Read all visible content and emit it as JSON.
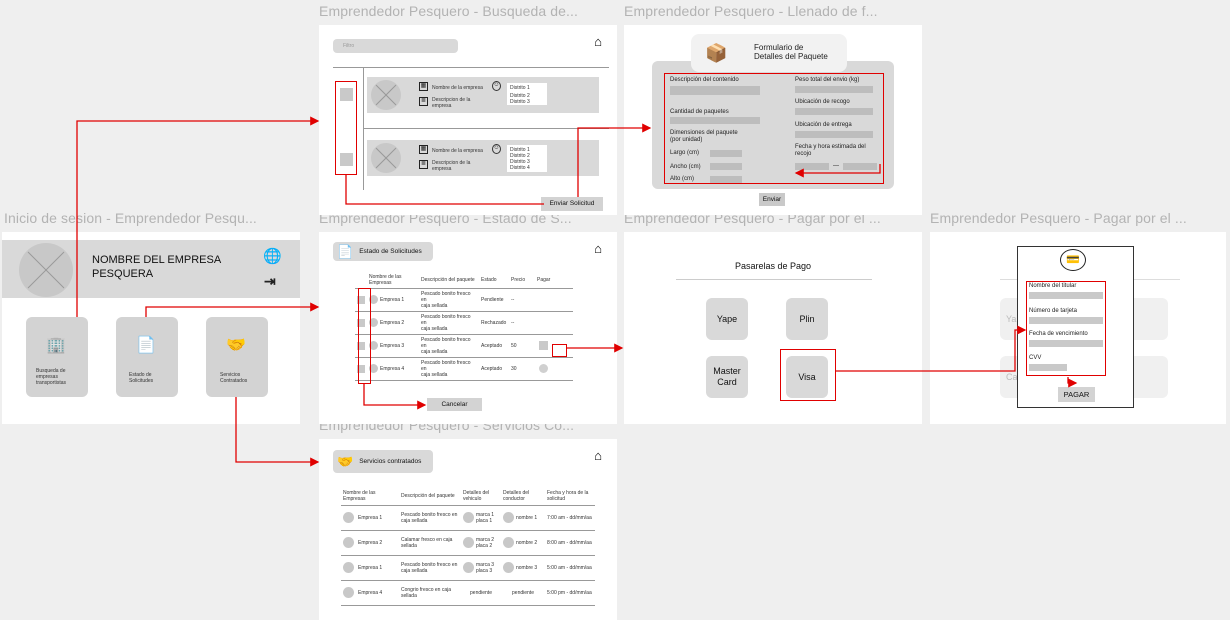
{
  "frame_titles": {
    "busqueda": "Emprendedor Pesquero - Busqueda de...",
    "llenado": "Emprendedor Pesquero - Llenado de f...",
    "login": "Inicio de sesion - Emprendedor Pesqu...",
    "estado": "Emprendedor Pesquero - Estado de S...",
    "pagar1": "Emprendedor Pesquero - Pagar por el ...",
    "pagar2": "Emprendedor Pesquero - Pagar por el ...",
    "servicios": "Emprendedor Pesquero - Servicios Co..."
  },
  "busqueda": {
    "search_placeholder": "Filtro",
    "results": [
      {
        "name": "Nombre de la empresa",
        "description": "Descripcion de la empresa",
        "districts": [
          "Distrito 1",
          "Distrito 2",
          "Distrito 3"
        ]
      },
      {
        "name": "Nombre de la empresa",
        "description": "Descripcion de la empresa",
        "districts": [
          "Distrito 1",
          "Distrito 2",
          "Distrito 3",
          "Distrito 4"
        ]
      }
    ],
    "submit_label": "Enviar Solicitud"
  },
  "form": {
    "title_line1": "Formulario de",
    "title_line2": "Detalles del Paquete",
    "left_fields": {
      "descripcion": "Descripción del contenido",
      "cantidad": "Cantidad de paquetes",
      "dim1": "Dimensiones del paquete",
      "dim2": "(por unidad)",
      "largo": "Largo (cm)",
      "ancho": "Ancho (cm)",
      "alto": "Alto (cm)"
    },
    "right_fields": {
      "peso": "Peso total del envio (kg)",
      "recojo": "Ubicación de recogo",
      "entrega": "Ubicación de entrega",
      "fecha1": "Fecha y hora estimada del",
      "fecha2": "recojo",
      "dash": "—"
    },
    "submit_label": "Enviar"
  },
  "login": {
    "company_line1": "NOMBRE DEL EMPRESA",
    "company_line2": "PESQUERA",
    "menu": [
      {
        "label_line1": "Busqueda de",
        "label_line2": "empresas",
        "label_line3": "transportistas"
      },
      {
        "label_line1": "Estado de",
        "label_line2": "Solicitudes",
        "label_line3": ""
      },
      {
        "label_line1": "Servicios",
        "label_line2": "Contratados",
        "label_line3": ""
      }
    ]
  },
  "estado": {
    "title": "Estado de Solicitudes",
    "headers": [
      "Nombre de las Empresas",
      "Descripción del paquete",
      "Estado",
      "Precio",
      "Pagar"
    ],
    "rows": [
      {
        "company": "Empresa 1",
        "desc1": "Pescado bonito fresco en",
        "desc2": "caja sellada",
        "status": "Pendiente",
        "price": "--"
      },
      {
        "company": "Empresa 2",
        "desc1": "Pescado bonito fresco en",
        "desc2": "caja sellada",
        "status": "Rechazado",
        "price": "--"
      },
      {
        "company": "Empresa 3",
        "desc1": "Pescado bonito fresco en",
        "desc2": "caja sellada",
        "status": "Aceptado",
        "price": "50"
      },
      {
        "company": "Empresa 4",
        "desc1": "Pescado bonito fresco en",
        "desc2": "caja sellada",
        "status": "Aceptado",
        "price": "30"
      }
    ],
    "cancel_label": "Cancelar"
  },
  "pasarelas": {
    "title": "Pasarelas de Pago",
    "options": [
      "Yape",
      "Plin",
      "Master Card",
      "Visa"
    ]
  },
  "card_form": {
    "fields": [
      "Nombre del titular",
      "Número de tarjeta",
      "Fecha de vencimiento",
      "CVV"
    ],
    "pay_label": "PAGAR",
    "bg_labels": [
      "Ya",
      "Ca"
    ]
  },
  "servicios": {
    "title": "Servicios contratados",
    "headers": [
      "Nombre de las Empresas",
      "Descripción del paquete",
      "Detalles del vehiculo",
      "Detalles del conductor",
      "Fecha y hora de la solicitud"
    ],
    "rows": [
      {
        "company": "Empresa 1",
        "desc1": "Pescado bonito fresco en",
        "desc2": "caja sellada",
        "veh1": "marca 1",
        "veh2": "placa 1",
        "driver": "nombre 1",
        "date": "7:00 am - dd/mm/aa"
      },
      {
        "company": "Empresa 2",
        "desc1": "Calamar fresco en caja",
        "desc2": "sellada",
        "veh1": "marca 2",
        "veh2": "placa 2",
        "driver": "nombre 2",
        "date": "8:00 am - dd/mm/aa"
      },
      {
        "company": "Empresa 1",
        "desc1": "Pescado bonito fresco en",
        "desc2": "caja sellada",
        "veh1": "marca 3",
        "veh2": "placa 3",
        "driver": "nombre 3",
        "date": "5:00 am - dd/mm/aa"
      },
      {
        "company": "Empresa 4",
        "desc1": "Congrio fresco en caja",
        "desc2": "sellada",
        "veh1": "pendiente",
        "veh2": "",
        "driver": "pendiente",
        "date": "5:00 pm - dd/mm/aa"
      }
    ]
  },
  "colors": {
    "accent_red": "#e00000",
    "canvas": "#efefef",
    "frame": "#ffffff",
    "placeholder": "#d9d9d9"
  }
}
